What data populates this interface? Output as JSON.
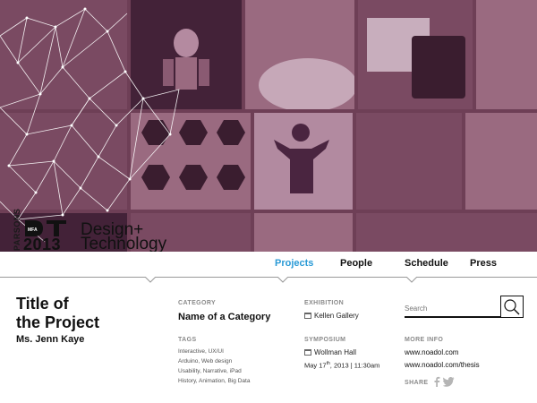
{
  "logo": {
    "school": "PARSONS",
    "mfa": "MFA",
    "year": "2013",
    "line1": "Design+",
    "line2": "Technology"
  },
  "nav": {
    "items": [
      "Projects",
      "People",
      "Schedule",
      "Press"
    ],
    "active": "Projects",
    "active_color": "#2a9ad6"
  },
  "project": {
    "title_line1": "Title of",
    "title_line2": "the Project",
    "author": "Ms. Jenn Kaye"
  },
  "category": {
    "label": "CATEGORY",
    "value": "Name of a Category"
  },
  "tags": {
    "label": "TAGS",
    "lines": [
      "Interactive, UX/UI",
      "Arduino, Web design",
      "Usability, Narrative, iPad",
      "History, Animation, Big Data"
    ]
  },
  "exhibition": {
    "label": "EXHIBITION",
    "value": "Kellen Gallery",
    "icon": "calendar-icon"
  },
  "symposium": {
    "label": "SYMPOSIUM",
    "value": "Wollman Hall",
    "date_prefix": "May 17",
    "date_sup": "th",
    "date_suffix": ", 2013  |  11:30am",
    "icon": "calendar-icon"
  },
  "search": {
    "placeholder": "Search",
    "icon": "search-icon"
  },
  "more_info": {
    "label": "MORE INFO",
    "links": [
      "www.noadol.com",
      "www.noadol.com/thesis"
    ]
  },
  "share": {
    "label": "SHARE",
    "icons": [
      "facebook-icon",
      "twitter-icon"
    ]
  },
  "colors": {
    "hero_tint": "#6e3f56",
    "accent": "#2a9ad6"
  }
}
